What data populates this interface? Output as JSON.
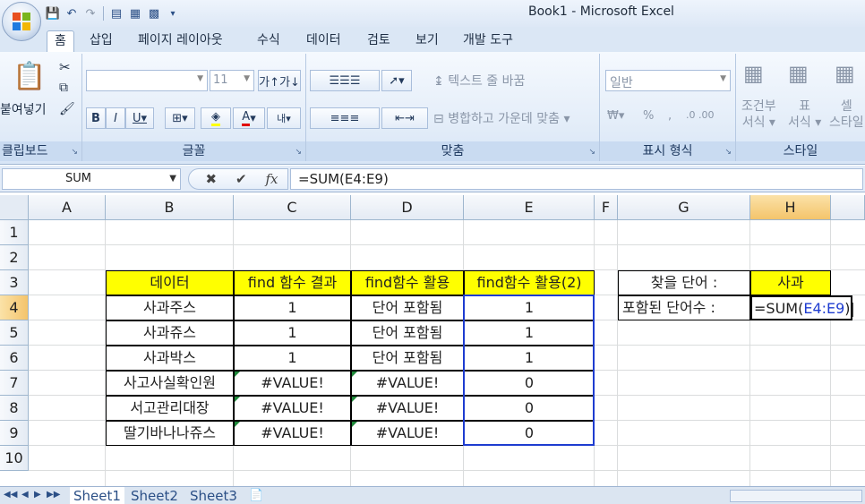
{
  "window": {
    "title": "Book1 - Microsoft Excel"
  },
  "tabs": [
    {
      "label": "홈",
      "active": true
    },
    {
      "label": "삽입"
    },
    {
      "label": "페이지 레이아웃"
    },
    {
      "label": "수식"
    },
    {
      "label": "데이터"
    },
    {
      "label": "검토"
    },
    {
      "label": "보기"
    },
    {
      "label": "개발 도구"
    }
  ],
  "ribbon": {
    "clipboard": {
      "label": "클립보드",
      "paste": "붙여넣기"
    },
    "font": {
      "label": "글꼴",
      "size": "11"
    },
    "alignment": {
      "label": "맞춤",
      "wrap_text": "텍스트 줄 바꿈",
      "merge_center": "병합하고 가운데 맞춤"
    },
    "number": {
      "label": "표시 형식",
      "format": "일반"
    },
    "styles": {
      "label": "스타일",
      "conditional": "조건부",
      "conditional2": "서식",
      "table": "표",
      "table2": "서식",
      "cell": "셀",
      "cell2": "스타일"
    }
  },
  "formula_bar": {
    "name_box": "SUM",
    "formula": "=SUM(E4:E9)"
  },
  "columns": [
    "A",
    "B",
    "C",
    "D",
    "E",
    "F",
    "G",
    "H"
  ],
  "rows": [
    "1",
    "2",
    "3",
    "4",
    "5",
    "6",
    "7",
    "8",
    "9",
    "10"
  ],
  "table": {
    "headers": [
      "데이터",
      "find 함수 결과",
      "find함수 활용",
      "find함수 활용(2)"
    ],
    "rows": [
      [
        "사과주스",
        "1",
        "단어 포함됨",
        "1"
      ],
      [
        "사과쥬스",
        "1",
        "단어 포함됨",
        "1"
      ],
      [
        "사과박스",
        "1",
        "단어 포함됨",
        "1"
      ],
      [
        "사고사실확인원",
        "#VALUE!",
        "#VALUE!",
        "0"
      ],
      [
        "서고관리대장",
        "#VALUE!",
        "#VALUE!",
        "0"
      ],
      [
        "딸기바나나쥬스",
        "#VALUE!",
        "#VALUE!",
        "0"
      ]
    ]
  },
  "side": {
    "search_label": "찾을 단어 :",
    "search_value": "사과",
    "count_label": "포함된 단어수 :",
    "edit_prefix": "=SUM(",
    "edit_ref": "E4:E9",
    "edit_suffix": ")"
  },
  "sheets": [
    "Sheet1",
    "Sheet2",
    "Sheet3"
  ],
  "colors": {
    "header_fill": "#ffff00",
    "selection": "#f4c46b",
    "ref_blue": "#1e3cd0"
  }
}
